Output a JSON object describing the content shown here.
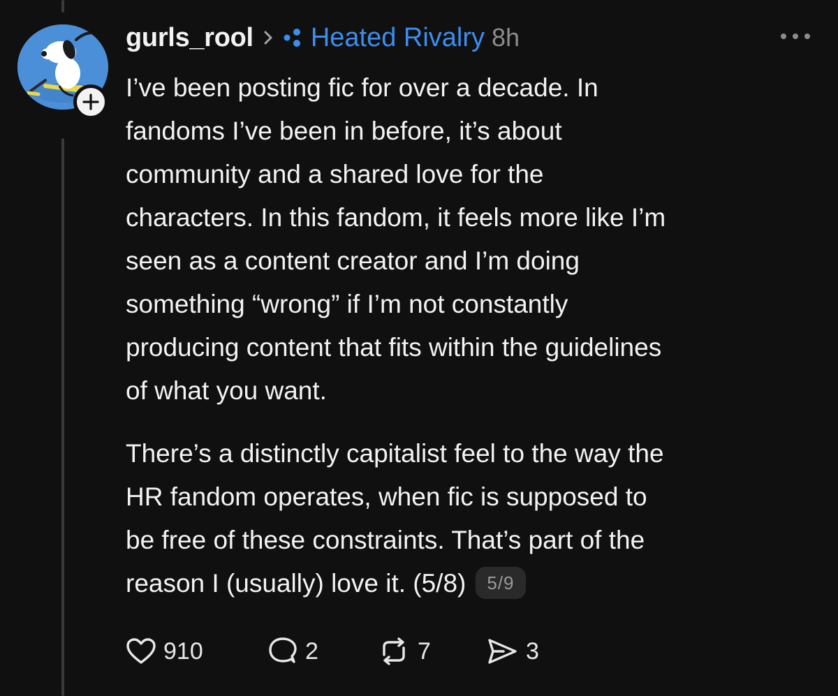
{
  "post": {
    "author": "gurls_rool",
    "community": "Heated Rivalry",
    "timestamp": "8h",
    "paragraph1": [
      "I’ve been posting fic for over a decade. In",
      "fandoms I’ve been in before, it’s about",
      "community and a shared love for the",
      "characters. In this fandom, it feels more like I’m",
      "seen as a content creator and I’m doing",
      "something “wrong” if I’m not constantly",
      "producing content that fits within the guidelines",
      "of what you want."
    ],
    "paragraph2": [
      "There’s a distinctly capitalist feel to the way the",
      "HR fandom operates, when fic is supposed to",
      "be free of these constraints. That’s part of the",
      "reason I (usually) love it. (5/8)"
    ],
    "page_indicator": "5/9"
  },
  "actions": {
    "likes": "910",
    "replies": "2",
    "reposts": "7",
    "shares": "3"
  },
  "icons": {
    "avatar": "snoopy-hockey-avatar",
    "follow": "plus-icon",
    "chevron": "chevron-right-icon",
    "community": "community-dots-icon",
    "more": "more-dots-icon",
    "like": "heart-icon",
    "reply": "reply-bubble-icon",
    "repost": "repost-icon",
    "share": "send-icon"
  },
  "colors": {
    "background": "#101010",
    "text": "#f3f3f3",
    "accent": "#3b8ef0",
    "muted": "#8d8d8d"
  }
}
